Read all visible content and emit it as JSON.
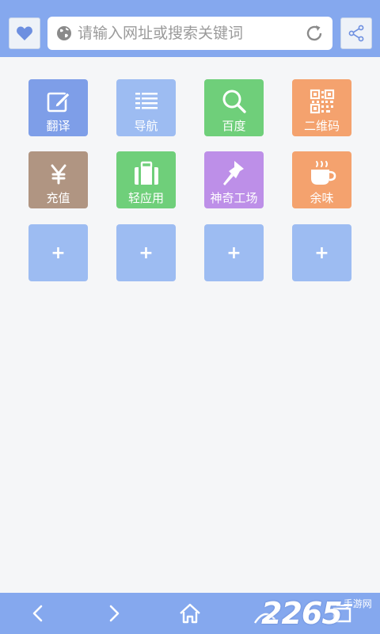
{
  "search": {
    "placeholder": "请输入网址或搜索关键词",
    "value": ""
  },
  "tiles": [
    {
      "label": "翻译",
      "icon": "edit-icon",
      "color": "#7e9ee8"
    },
    {
      "label": "导航",
      "icon": "list-icon",
      "color": "#9dbcf2"
    },
    {
      "label": "百度",
      "icon": "search-icon",
      "color": "#6fcf7a"
    },
    {
      "label": "二维码",
      "icon": "qr-code-icon",
      "color": "#f4a26e"
    },
    {
      "label": "充值",
      "icon": "yen-icon",
      "color": "#b09582"
    },
    {
      "label": "轻应用",
      "icon": "suitcase-icon",
      "color": "#6fcf7a"
    },
    {
      "label": "神奇工场",
      "icon": "pin-icon",
      "color": "#bd8fe8"
    },
    {
      "label": "余味",
      "icon": "cup-icon",
      "color": "#f4a26e"
    }
  ],
  "add_tiles": [
    "+",
    "+",
    "+",
    "+"
  ],
  "watermark": {
    "number": "2265",
    "text": "手游网"
  }
}
